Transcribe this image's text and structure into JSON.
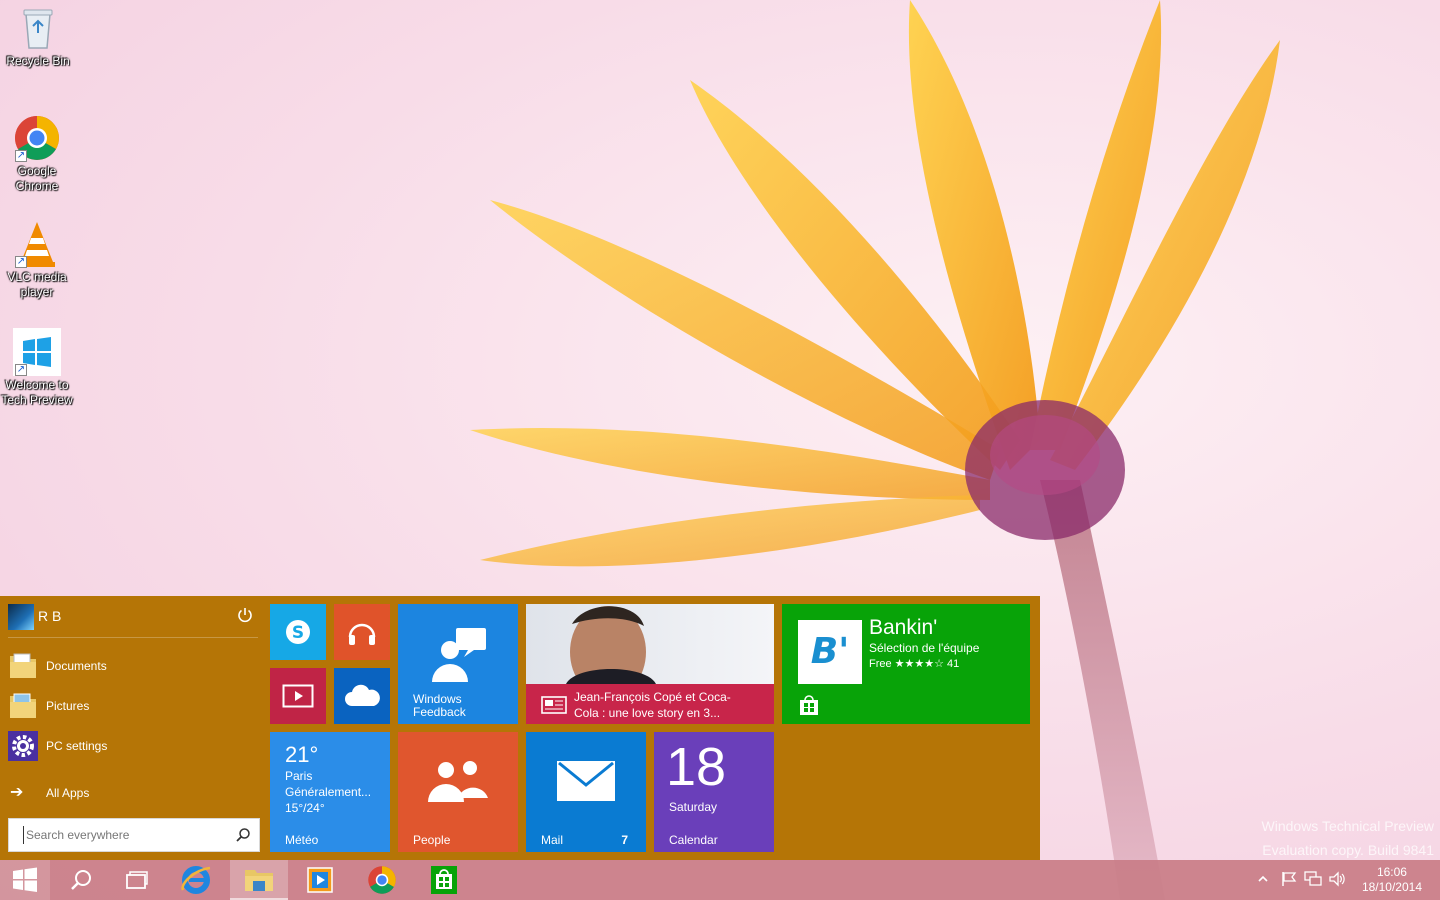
{
  "desktop": {
    "icons": [
      {
        "label": "Recycle Bin",
        "icon": "recycle-bin-icon"
      },
      {
        "label": "Google Chrome",
        "icon": "chrome-icon"
      },
      {
        "label": "VLC media player",
        "icon": "vlc-icon"
      },
      {
        "label": "Welcome to Tech Preview",
        "icon": "windows-logo-icon"
      }
    ],
    "watermark_line1": "Windows Technical Preview",
    "watermark_line2": "Evaluation copy. Build 9841"
  },
  "start_menu": {
    "accent": "#b57506",
    "user_name": "R B",
    "places": [
      {
        "label": "Documents",
        "icon": "documents-folder-icon"
      },
      {
        "label": "Pictures",
        "icon": "pictures-folder-icon"
      },
      {
        "label": "PC settings",
        "icon": "settings-gear-icon"
      }
    ],
    "all_apps_label": "All Apps",
    "search_placeholder": "Search everywhere"
  },
  "tiles": {
    "feedback": {
      "label": "Windows Feedback",
      "line1": "Windows",
      "line2": "Feedback",
      "color": "#1c85e0"
    },
    "news": {
      "headline_line1": "Jean-François Copé et Coca-",
      "headline_line2": "Cola : une love story en 3...",
      "color": "#c8254a"
    },
    "store": {
      "app_name": "Bankin'",
      "subtitle": "Sélection de l'équipe",
      "rating_line": "Free ★★★★☆ 41",
      "logo_text": "B'",
      "color": "#08a308"
    },
    "weather": {
      "temp": "21°",
      "city": "Paris",
      "condition": "Généralement...",
      "range": "15°/24°",
      "label": "Météo",
      "color": "#2b8de8"
    },
    "people": {
      "label": "People",
      "color": "#e0562e"
    },
    "mail": {
      "label": "Mail",
      "count": "7",
      "color": "#0a7bd2"
    },
    "calendar": {
      "day": "18",
      "weekday": "Saturday",
      "label": "Calendar",
      "color": "#6a3fba"
    },
    "skype": {
      "color": "#16a8e6"
    },
    "music": {
      "color": "#e0532a"
    },
    "video": {
      "color": "#c02446"
    },
    "onedrive": {
      "color": "#0a63c0"
    }
  },
  "taskbar": {
    "clock_time": "16:06",
    "clock_date": "18/10/2014"
  }
}
